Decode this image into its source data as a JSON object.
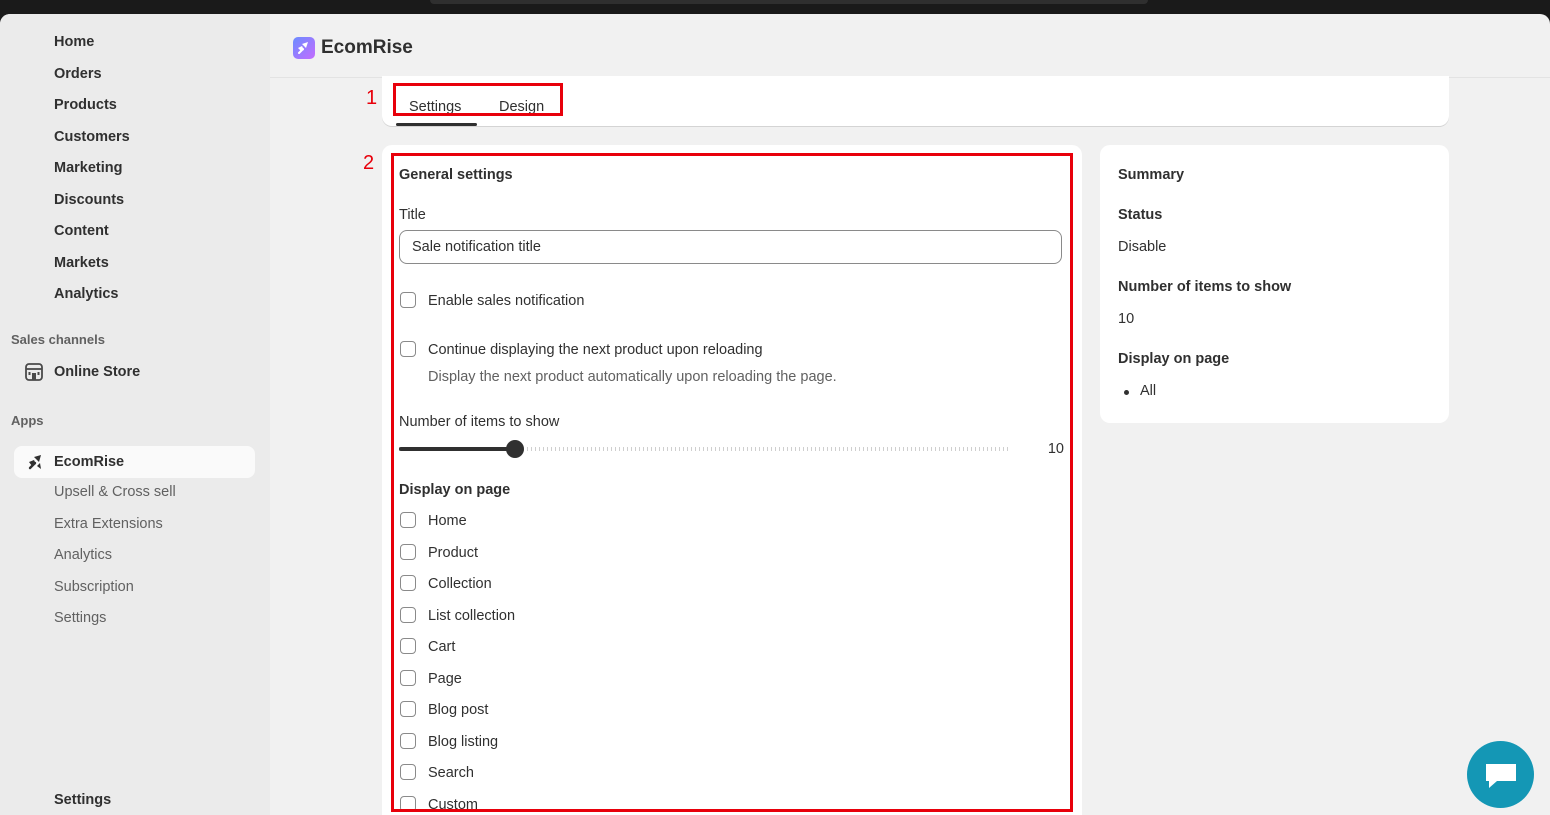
{
  "sidebar": {
    "nav": [
      "Home",
      "Orders",
      "Products",
      "Customers",
      "Marketing",
      "Discounts",
      "Content",
      "Markets",
      "Analytics"
    ],
    "sales_channels_label": "Sales channels",
    "online_store": "Online Store",
    "apps_label": "Apps",
    "app_name": "EcomRise",
    "app_sub": [
      "Upsell & Cross sell",
      "Extra Extensions",
      "Analytics",
      "Subscription",
      "Settings"
    ],
    "settings": "Settings"
  },
  "header": {
    "brand": "EcomRise"
  },
  "tabs": [
    "Settings",
    "Design"
  ],
  "annotations": {
    "one": "1",
    "two": "2"
  },
  "general": {
    "heading": "General settings",
    "title_label": "Title",
    "title_value": "Sale notification title",
    "enable_label": "Enable sales notification",
    "continue_label": "Continue displaying the next product upon reloading",
    "continue_help": "Display the next product automatically upon reloading the page.",
    "items_label": "Number of items to show",
    "items_value": "10",
    "items_fraction": 0.19,
    "display_label": "Display on page",
    "pages": [
      "Home",
      "Product",
      "Collection",
      "List collection",
      "Cart",
      "Page",
      "Blog post",
      "Blog listing",
      "Search",
      "Custom"
    ]
  },
  "summary": {
    "title": "Summary",
    "status_label": "Status",
    "status_value": "Disable",
    "items_label": "Number of items to show",
    "items_value": "10",
    "display_label": "Display on page",
    "display_value": "All"
  },
  "colors": {
    "annotation": "#e8000b",
    "chat": "#1497b5"
  }
}
